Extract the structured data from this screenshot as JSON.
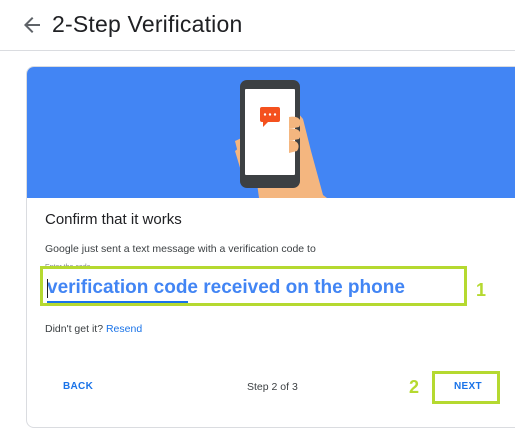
{
  "header": {
    "back_icon": "arrow-left-icon",
    "title": "2-Step Verification"
  },
  "card": {
    "hero_illustration": "phone-message-illustration",
    "confirm_title": "Confirm that it works",
    "sent_text": "Google just sent a text message with a verification code to",
    "enter_label": "Enter the code",
    "code_value": "verification code received on the phone",
    "didnt_get": "Didn't get it?",
    "resend_label": "Resend",
    "back_label": "BACK",
    "step_text": "Step 2 of 3",
    "next_label": "NEXT"
  },
  "annotations": {
    "marker1": "1",
    "marker2": "2",
    "highlight_color": "#b5d930"
  },
  "colors": {
    "hero_bg": "#4285f4",
    "link": "#1a73e8",
    "code_text": "#4285f4",
    "message_bubble": "#f4511e"
  }
}
